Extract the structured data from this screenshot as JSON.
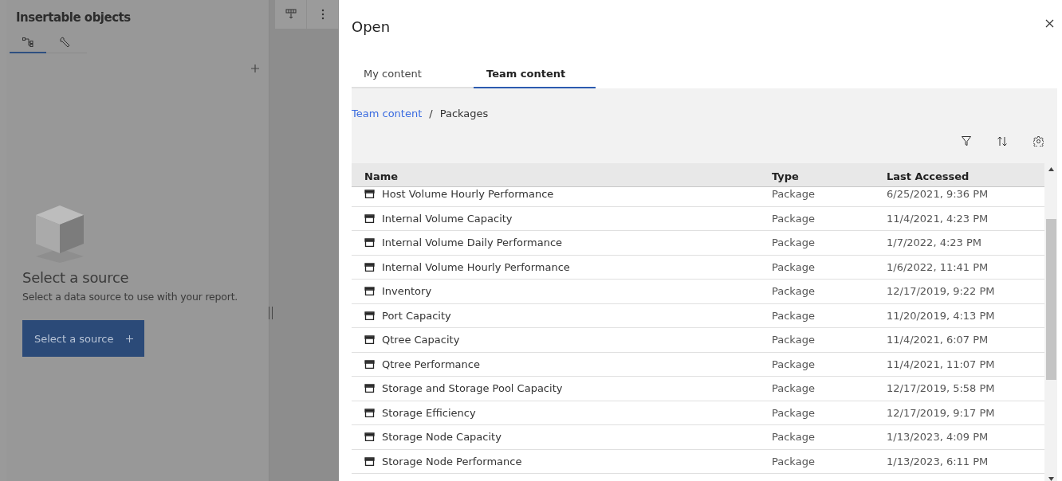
{
  "side_panel": {
    "title": "Insertable objects",
    "tabs": [
      {
        "kind": "tree",
        "selected": true
      },
      {
        "kind": "tools",
        "selected": false
      }
    ],
    "empty_state": {
      "heading": "Select a source",
      "description": "Select a data source to use with your report.",
      "button": "Select a source"
    }
  },
  "dialog": {
    "title": "Open",
    "tabs": [
      {
        "label": "My content",
        "selected": false
      },
      {
        "label": "Team content",
        "selected": true
      }
    ],
    "breadcrumb_separator": "/",
    "breadcrumb": [
      {
        "label": "Team content",
        "link": true
      },
      {
        "label": "Packages",
        "link": false
      }
    ],
    "table": {
      "columns": [
        "Name",
        "Type",
        "Last Accessed"
      ],
      "rows": [
        {
          "name": "Host Volume Hourly Performance",
          "type": "Package",
          "last_accessed": "6/25/2021, 9:36 PM"
        },
        {
          "name": "Internal Volume Capacity",
          "type": "Package",
          "last_accessed": "11/4/2021, 4:23 PM"
        },
        {
          "name": "Internal Volume Daily Performance",
          "type": "Package",
          "last_accessed": "1/7/2022, 4:23 PM"
        },
        {
          "name": "Internal Volume Hourly Performance",
          "type": "Package",
          "last_accessed": "1/6/2022, 11:41 PM"
        },
        {
          "name": "Inventory",
          "type": "Package",
          "last_accessed": "12/17/2019, 9:22 PM"
        },
        {
          "name": "Port Capacity",
          "type": "Package",
          "last_accessed": "11/20/2019, 4:13 PM"
        },
        {
          "name": "Qtree Capacity",
          "type": "Package",
          "last_accessed": "11/4/2021, 6:07 PM"
        },
        {
          "name": "Qtree Performance",
          "type": "Package",
          "last_accessed": "11/4/2021, 11:07 PM"
        },
        {
          "name": "Storage and Storage Pool Capacity",
          "type": "Package",
          "last_accessed": "12/17/2019, 5:58 PM"
        },
        {
          "name": "Storage Efficiency",
          "type": "Package",
          "last_accessed": "12/17/2019, 9:17 PM"
        },
        {
          "name": "Storage Node Capacity",
          "type": "Package",
          "last_accessed": "1/13/2023, 4:09 PM"
        },
        {
          "name": "Storage Node Performance",
          "type": "Package",
          "last_accessed": "1/13/2023, 6:11 PM"
        }
      ]
    }
  }
}
